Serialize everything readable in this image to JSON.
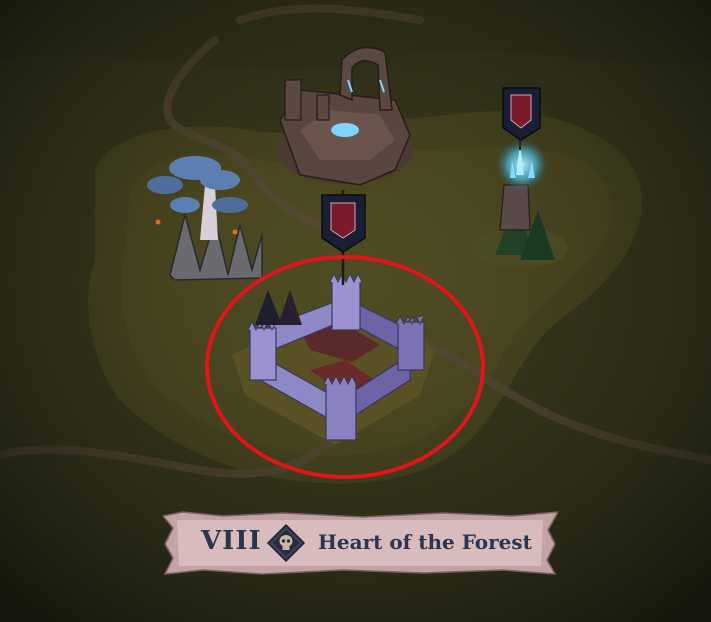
{
  "level_banner": {
    "chapter_numeral": "VIII",
    "level_title": "Heart of the Forest",
    "emblem_icon": "skull-icon"
  },
  "map": {
    "nodes": [
      {
        "name": "ancient-portal-ruins",
        "icon": "portal-ruins-icon"
      },
      {
        "name": "crystal-watchtower",
        "icon": "crystal-tower-icon"
      },
      {
        "name": "haunted-blue-tree",
        "icon": "tree-icon"
      },
      {
        "name": "castle-fortress",
        "icon": "castle-icon",
        "selected": true
      }
    ],
    "colors": {
      "terrain": "#3a3a1e",
      "path": "#5a4a3a",
      "selection_ring": "#e0161b",
      "banner_flag": "#1a1f33",
      "castle": "#8078b8",
      "crystal_glow": "#5fd8ff"
    }
  }
}
